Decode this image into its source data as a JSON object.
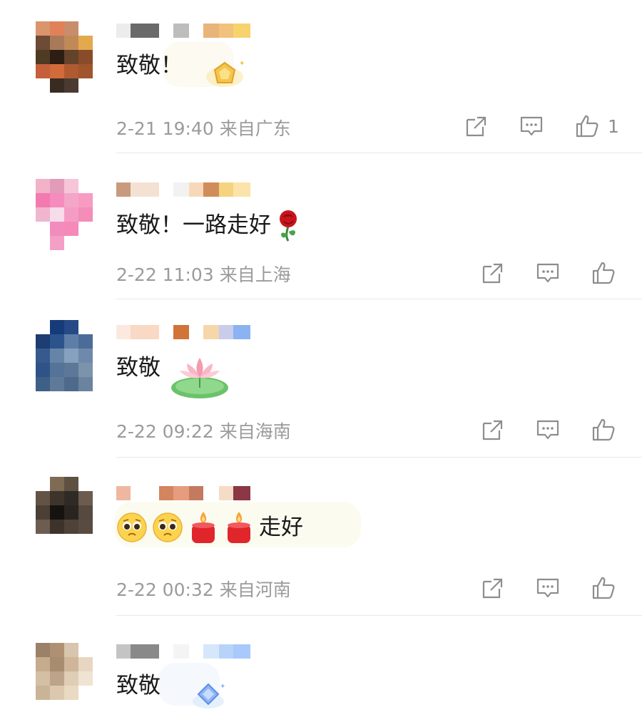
{
  "comments": [
    {
      "text": "致敬！",
      "time": "2-21 19:40",
      "location": "来自广东",
      "likes": "1",
      "avatar": [
        "#d9956b",
        "#e0815a",
        "#c98d6b",
        "#ffffff",
        "#6d4b36",
        "#a97a58",
        "#c08a57",
        "#e3a94e",
        "#4f3a23",
        "#2c1e12",
        "#63432a",
        "#8a4b2b",
        "#c5603a",
        "#d36a3a",
        "#b05a30",
        "#a0552d",
        "#ffffff",
        "#3a2b22",
        "#4b3a31",
        "#ffffff"
      ],
      "name_blocks": [
        "#ececec",
        "#6a6a6a",
        "#ffffff",
        "#bdbdbd",
        "#ffffff",
        "#e8b47a",
        "#f1c27b",
        "#f7d36e"
      ]
    },
    {
      "text": "致敬！一路走好",
      "time": "2-22 11:03",
      "location": "来自上海",
      "likes": "",
      "avatar": [
        "#f2b2c8",
        "#e29bb8",
        "#f7c5d8",
        "#ffffff",
        "#f27ab0",
        "#f68bbd",
        "#f4a6c8",
        "#f79bc2",
        "#f0b6cf",
        "#f7dcea",
        "#f59cc3",
        "#f48db8",
        "#ffffff",
        "#f18cbc",
        "#f58ab9",
        "#ffffff",
        "#ffffff",
        "#f4a0c6",
        "#ffffff",
        "#ffffff"
      ],
      "name_blocks": [
        "#c99b7e",
        "#f5e1d3",
        "#ffffff",
        "#f2f2f2",
        "#f7d9b9",
        "#d08d5a",
        "#f6d37f",
        "#fbe3a9"
      ]
    },
    {
      "text": "致敬",
      "time": "2-22 09:22",
      "location": "来自海南",
      "likes": "",
      "avatar": [
        "#ffffff",
        "#173b78",
        "#264a86",
        "#ffffff",
        "#1d3d73",
        "#2c548c",
        "#5e7ea8",
        "#4b6c98",
        "#365a8d",
        "#6584a8",
        "#86a0bf",
        "#6f89ab",
        "#2f5387",
        "#547399",
        "#5b7898",
        "#7c93ac",
        "#3e5f86",
        "#5e7a98",
        "#4d6a8c",
        "#6b839f"
      ],
      "name_blocks": [
        "#fbe9e0",
        "#f9d8c4",
        "#ffffff",
        "#d0743a",
        "#ffffff",
        "#f7d6aa",
        "#c9ccea",
        "#8bb3f2"
      ]
    },
    {
      "text": "走好",
      "time": "2-22 00:32",
      "location": "来自河南",
      "likes": "",
      "avatar": [
        "#ffffff",
        "#7f6a54",
        "#5f5142",
        "#ffffff",
        "#625345",
        "#3e342c",
        "#2f2a26",
        "#6b5c4f",
        "#4b3f36",
        "#16120f",
        "#2a2420",
        "#564a40",
        "#6d5c50",
        "#3e332b",
        "#4f4238",
        "#5a4b40",
        "#ffffff",
        "#ffffff",
        "#ffffff",
        "#ffffff"
      ],
      "name_blocks": [
        "#f0b7a0",
        "#ffffff",
        "#d4855e",
        "#e59d7d",
        "#c47a60",
        "#ffffff",
        "#f5dcc7",
        "#8b3744"
      ]
    },
    {
      "text": "致敬",
      "time": "",
      "location": "",
      "likes": "",
      "avatar": [
        "#9a8168",
        "#b09073",
        "#d8c5ad",
        "#ffffff",
        "#c6ab8c",
        "#a88c70",
        "#cfb69a",
        "#e7d7c2",
        "#d3bfa4",
        "#bca38a",
        "#e0cdb6",
        "#f0e3d2",
        "#c9b498",
        "#dcc8ae",
        "#ead9c3",
        "#ffffff",
        "#ffffff",
        "#ffffff",
        "#ffffff",
        "#ffffff"
      ],
      "name_blocks": [
        "#c4c4c4",
        "#898989",
        "#ffffff",
        "#f4f4f4",
        "#ffffff",
        "#d7e7fb",
        "#b7d3fa",
        "#a7c9fb"
      ]
    }
  ],
  "icons": {
    "share": "share-icon",
    "reply": "comment-icon",
    "like": "thumbs-up-icon"
  }
}
